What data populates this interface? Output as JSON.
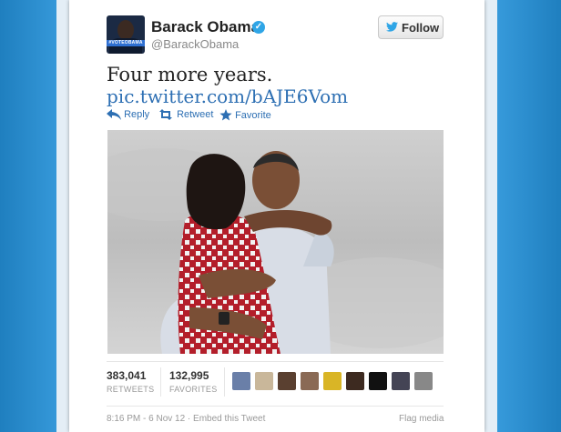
{
  "tweet": {
    "author_name": "Barack Obama",
    "handle": "@BarackObama",
    "avatar_badge": "#VOTEOBAMA",
    "follow_label": "Follow",
    "text": "Four more years.",
    "link": "pic.twitter.com/bAJE6Vom"
  },
  "actions": {
    "reply": "Reply",
    "retweet": "Retweet",
    "favorite": "Favorite"
  },
  "stats": {
    "retweets_count": "383,041",
    "retweets_label": "RETWEETS",
    "favorites_count": "132,995",
    "favorites_label": "FAVORITES"
  },
  "footer": {
    "timestamp": "8:16 PM - 6 Nov 12 · Embed this Tweet",
    "flag": "Flag media"
  },
  "colors": {
    "page_blue": "#2f8fcf",
    "link_blue": "#2d6fb3",
    "verified_blue": "#2fa5e6"
  },
  "icons": [
    "twitter-bird-icon",
    "verified-check-icon",
    "reply-arrow-icon",
    "retweet-icon",
    "star-icon"
  ]
}
